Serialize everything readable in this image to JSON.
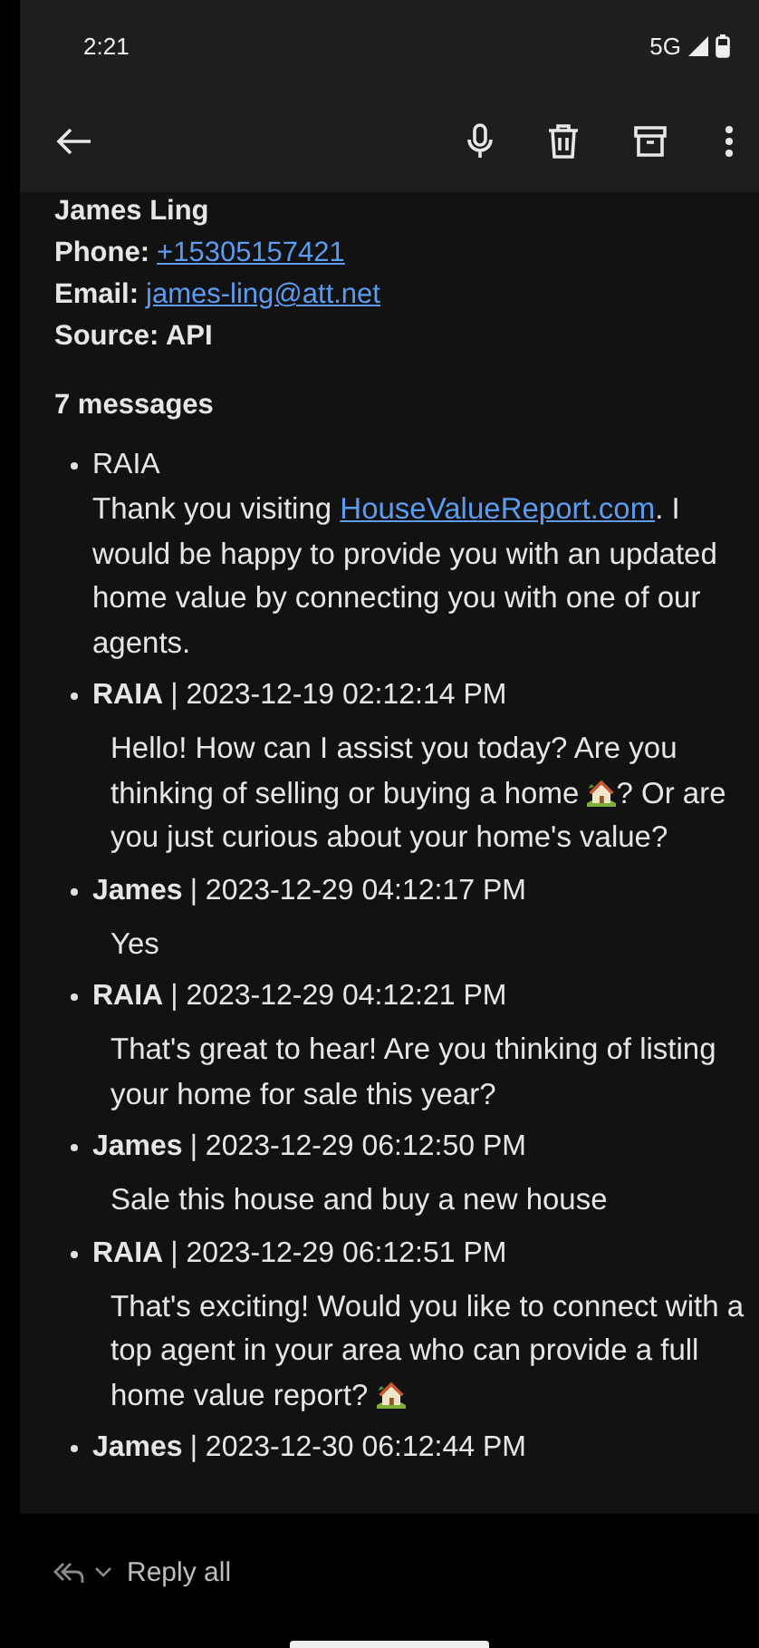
{
  "status_bar": {
    "time": "2:21",
    "network": "5G"
  },
  "toolbar": {
    "actions": [
      {
        "kind": "mic"
      },
      {
        "kind": "delete"
      },
      {
        "kind": "archive"
      },
      {
        "kind": "more"
      }
    ]
  },
  "contact": {
    "name": "James Ling",
    "phone_label": "Phone:",
    "phone": "+15305157421",
    "email_label": "Email:",
    "email": "james-ling@att.net",
    "source": "Source: API"
  },
  "thread": {
    "count": "7 messages",
    "messages": [
      {
        "kind": "intro",
        "sender": "RAIA",
        "body": [
          {
            "kind": "text",
            "text": "Thank you visiting "
          },
          {
            "kind": "link",
            "text": "HouseValueReport.com"
          },
          {
            "kind": "text",
            "text": ". I would be happy to provide you with an updated home value by connecting you with one of our agents."
          }
        ]
      },
      {
        "kind": "chat",
        "sender": "RAIA",
        "timestamp": "| 2023-12-19 02:12:14 PM",
        "body": [
          {
            "kind": "text",
            "text": "Hello! How can I assist you today? Are you thinking of selling or buying a home "
          },
          {
            "kind": "emoji"
          },
          {
            "kind": "text",
            "text": "? Or are you just curious about your home's value?"
          }
        ]
      },
      {
        "kind": "chat",
        "sender": "James",
        "timestamp": "| 2023-12-29 04:12:17 PM",
        "body": [
          {
            "kind": "text",
            "text": "Yes"
          }
        ]
      },
      {
        "kind": "chat",
        "sender": "RAIA",
        "timestamp": "| 2023-12-29 04:12:21 PM",
        "body": [
          {
            "kind": "text",
            "text": "That's great to hear! Are you thinking of listing your home for sale this year?"
          }
        ]
      },
      {
        "kind": "chat",
        "sender": "James",
        "timestamp": "| 2023-12-29 06:12:50 PM",
        "body": [
          {
            "kind": "text",
            "text": "Sale this house and buy a new house"
          }
        ]
      },
      {
        "kind": "chat",
        "sender": "RAIA",
        "timestamp": "| 2023-12-29 06:12:51 PM",
        "body": [
          {
            "kind": "text",
            "text": "That's exciting! Would you like to connect with a top agent in your area who can provide a full home value report? "
          },
          {
            "kind": "emoji"
          }
        ]
      },
      {
        "kind": "chat",
        "sender": "James",
        "timestamp": "| 2023-12-30 06:12:44 PM"
      }
    ]
  },
  "reply_bar": {
    "label": "Reply all"
  }
}
